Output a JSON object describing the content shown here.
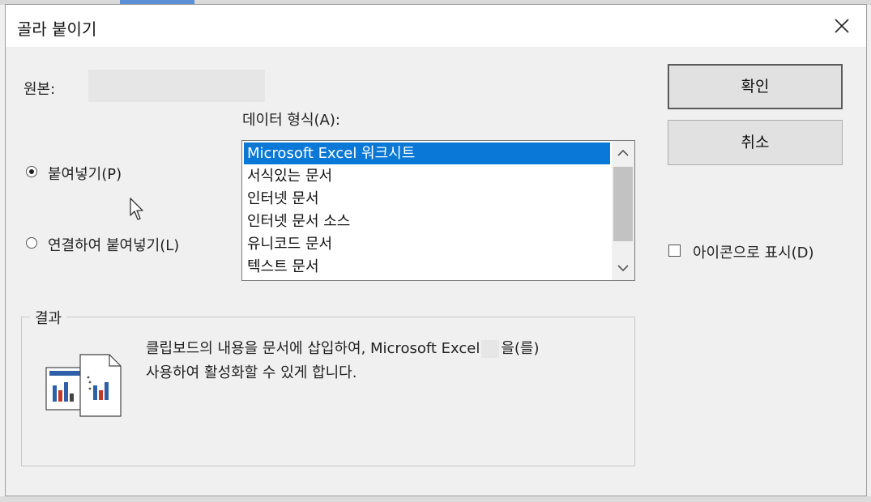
{
  "dialog": {
    "title": "골라 붙이기"
  },
  "source": {
    "label": "원본:"
  },
  "format": {
    "label": "데이터 형식(A):",
    "items": [
      {
        "label": "Microsoft Excel 워크시트",
        "selected": true
      },
      {
        "label": "서식있는 문서",
        "selected": false
      },
      {
        "label": "인터넷 문서",
        "selected": false
      },
      {
        "label": "인터넷 문서 소스",
        "selected": false
      },
      {
        "label": "유니코드 문서",
        "selected": false
      },
      {
        "label": "텍스트 문서",
        "selected": false
      }
    ]
  },
  "options": {
    "paste": {
      "label": "붙여넣기(P)",
      "checked": true
    },
    "paste_link": {
      "label": "연결하여 붙여넣기(L)",
      "checked": false
    }
  },
  "buttons": {
    "ok": "확인",
    "cancel": "취소"
  },
  "display_as_icon": {
    "label": "아이콘으로 표시(D)",
    "checked": false
  },
  "result": {
    "legend": "결과",
    "line1_pre": "클립보드의 내용을 문서에 삽입하여, Microsoft Excel",
    "line1_post": "을(를)",
    "line2": "사용하여 활성화할 수 있게 합니다."
  },
  "colors": {
    "selection": "#0a78d7",
    "background": "#f0f0f0",
    "accent": "#5b8fd6"
  }
}
